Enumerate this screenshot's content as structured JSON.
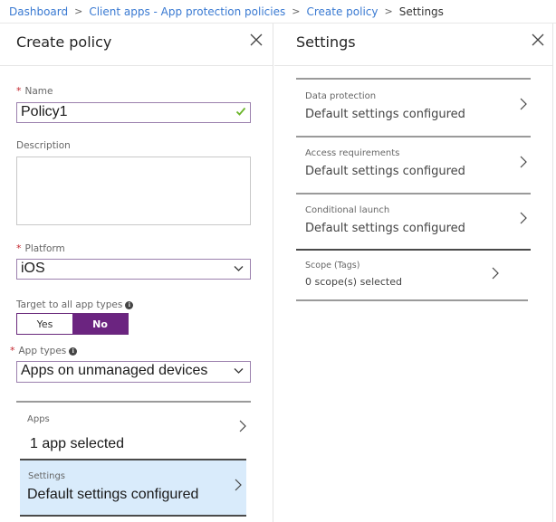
{
  "breadcrumb": {
    "items": [
      {
        "label": "Dashboard",
        "link": true
      },
      {
        "label": "Client apps - App protection policies",
        "link": true
      },
      {
        "label": "Create policy",
        "link": true
      },
      {
        "label": "Settings",
        "link": false
      }
    ],
    "separator": ">"
  },
  "create_policy": {
    "title": "Create policy",
    "close_icon": "close-icon",
    "name": {
      "label": "Name",
      "required": true,
      "value": "Policy1",
      "valid_icon": "check-icon"
    },
    "description": {
      "label": "Description",
      "value": ""
    },
    "platform": {
      "label": "Platform",
      "required": true,
      "value": "iOS"
    },
    "target_all": {
      "label": "Target to all app types",
      "options": [
        "Yes",
        "No"
      ],
      "selected": "No"
    },
    "app_types": {
      "label": "App types",
      "required": true,
      "value": "Apps on unmanaged devices"
    },
    "apps": {
      "label": "Apps",
      "value": "1 app selected"
    },
    "settings": {
      "label": "Settings",
      "value": "Default settings configured",
      "selected": true
    }
  },
  "settings_blade": {
    "title": "Settings",
    "close_icon": "close-icon",
    "items": [
      {
        "label": "Data protection",
        "value": "Default settings configured"
      },
      {
        "label": "Access requirements",
        "value": "Default settings configured"
      },
      {
        "label": "Conditional launch",
        "value": "Default settings configured"
      },
      {
        "label": "Scope (Tags)",
        "value": "0 scope(s) selected"
      }
    ]
  },
  "colors": {
    "link": "#3a7ad2",
    "accent_purple": "#6b2480",
    "required": "#c4262e",
    "selected_bg": "#d9ebfb",
    "valid_check": "#6bb52a"
  }
}
